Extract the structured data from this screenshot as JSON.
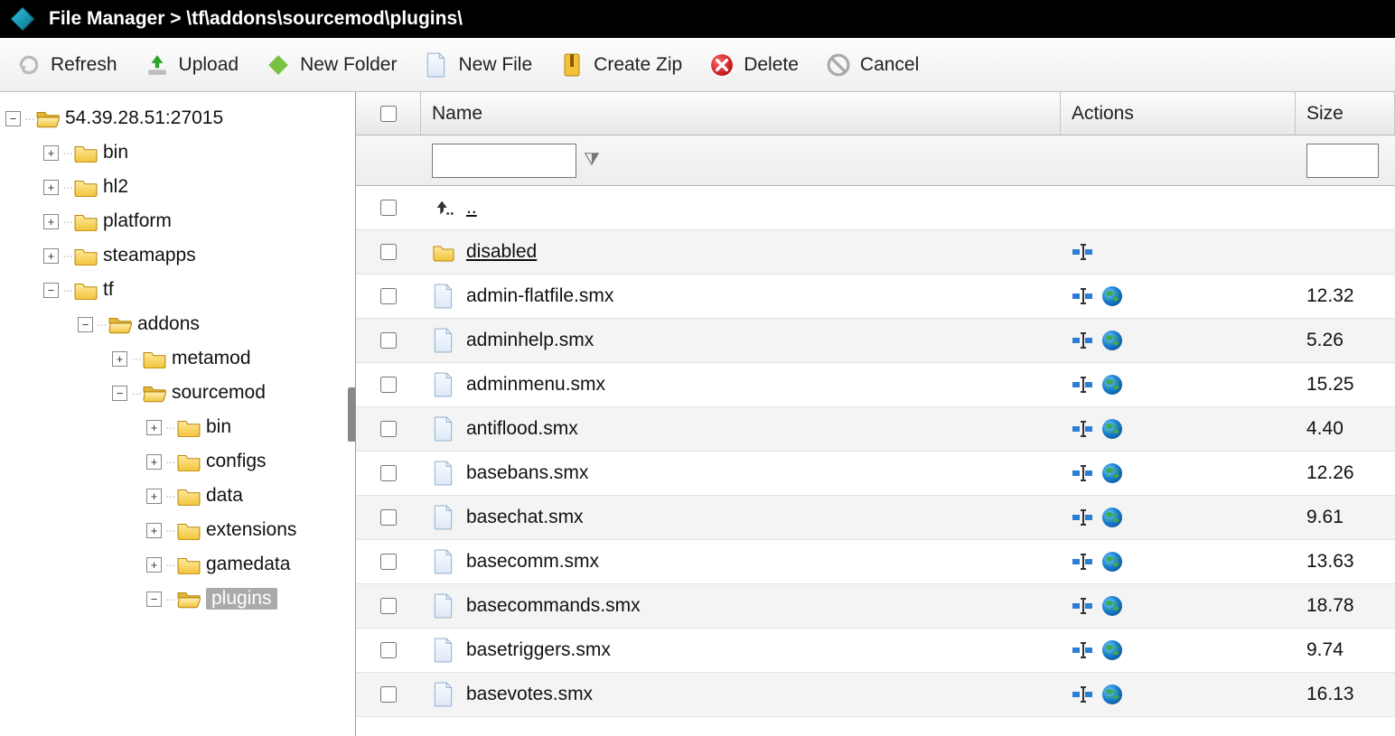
{
  "header": {
    "title": "File Manager > \\tf\\addons\\sourcemod\\plugins\\"
  },
  "toolbar": {
    "refresh": "Refresh",
    "upload": "Upload",
    "newFolder": "New Folder",
    "newFile": "New File",
    "createZip": "Create Zip",
    "delete": "Delete",
    "cancel": "Cancel"
  },
  "tree": {
    "root": "54.39.28.51:27015",
    "nodes": [
      {
        "label": "bin",
        "depth": 1,
        "toggle": "+",
        "selected": false
      },
      {
        "label": "hl2",
        "depth": 1,
        "toggle": "+",
        "selected": false
      },
      {
        "label": "platform",
        "depth": 1,
        "toggle": "+",
        "selected": false
      },
      {
        "label": "steamapps",
        "depth": 1,
        "toggle": "+",
        "selected": false
      },
      {
        "label": "tf",
        "depth": 1,
        "toggle": "-",
        "selected": false
      },
      {
        "label": "addons",
        "depth": 2,
        "toggle": "-",
        "selected": false,
        "open": true
      },
      {
        "label": "metamod",
        "depth": 3,
        "toggle": "+",
        "selected": false
      },
      {
        "label": "sourcemod",
        "depth": 3,
        "toggle": "-",
        "selected": false,
        "open": true
      },
      {
        "label": "bin",
        "depth": 4,
        "toggle": "+",
        "selected": false
      },
      {
        "label": "configs",
        "depth": 4,
        "toggle": "+",
        "selected": false
      },
      {
        "label": "data",
        "depth": 4,
        "toggle": "+",
        "selected": false
      },
      {
        "label": "extensions",
        "depth": 4,
        "toggle": "+",
        "selected": false
      },
      {
        "label": "gamedata",
        "depth": 4,
        "toggle": "+",
        "selected": false
      },
      {
        "label": "plugins",
        "depth": 4,
        "toggle": "-",
        "selected": true,
        "open": true
      }
    ]
  },
  "columns": {
    "name": "Name",
    "actions": "Actions",
    "size": "Size"
  },
  "filter": {
    "name": "",
    "size": ""
  },
  "upRow": "..",
  "files": [
    {
      "name": "disabled",
      "type": "folder",
      "size": ""
    },
    {
      "name": "admin-flatfile.smx",
      "type": "file",
      "size": "12.32"
    },
    {
      "name": "adminhelp.smx",
      "type": "file",
      "size": "5.26 "
    },
    {
      "name": "adminmenu.smx",
      "type": "file",
      "size": "15.25"
    },
    {
      "name": "antiflood.smx",
      "type": "file",
      "size": "4.40 "
    },
    {
      "name": "basebans.smx",
      "type": "file",
      "size": "12.26"
    },
    {
      "name": "basechat.smx",
      "type": "file",
      "size": "9.61 "
    },
    {
      "name": "basecomm.smx",
      "type": "file",
      "size": "13.63"
    },
    {
      "name": "basecommands.smx",
      "type": "file",
      "size": "18.78"
    },
    {
      "name": "basetriggers.smx",
      "type": "file",
      "size": "9.74 "
    },
    {
      "name": "basevotes.smx",
      "type": "file",
      "size": "16.13"
    }
  ]
}
